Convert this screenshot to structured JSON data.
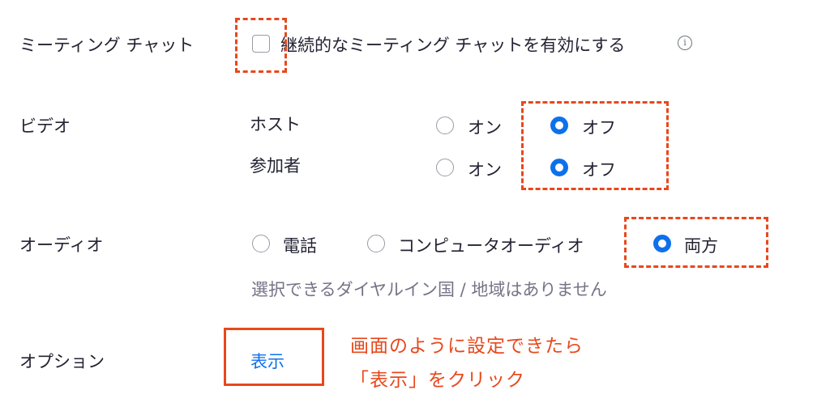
{
  "meeting_chat": {
    "label": "ミーティング チャット",
    "checkbox_label": "継続的なミーティング チャットを有効にする",
    "checked": false,
    "info_icon": "info-icon"
  },
  "video": {
    "label": "ビデオ",
    "host": {
      "label": "ホスト",
      "on_label": "オン",
      "off_label": "オフ",
      "selected": "オフ"
    },
    "participant": {
      "label": "参加者",
      "on_label": "オン",
      "off_label": "オフ",
      "selected": "オフ"
    }
  },
  "audio": {
    "label": "オーディオ",
    "options": [
      "電話",
      "コンピュータオーディオ",
      "両方"
    ],
    "selected": "両方",
    "note": "選択できるダイヤルイン国 / 地域はありません"
  },
  "options": {
    "label": "オプション",
    "show_button": "表示"
  },
  "annotation": {
    "line1": "画面のように設定できたら",
    "line2": "「表示」をクリック"
  },
  "colors": {
    "accent_blue": "#0e71eb",
    "annotation_red": "#e8481c",
    "text": "#232333",
    "muted": "#747487"
  }
}
